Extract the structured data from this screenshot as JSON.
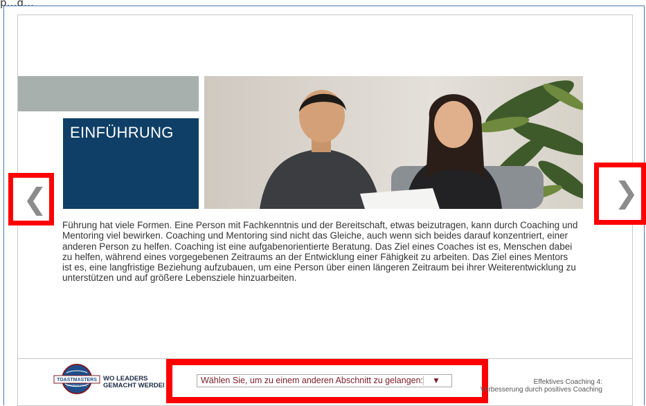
{
  "top_cutoff_text": "p…g…",
  "section": {
    "title": "EINFÜHRUNG",
    "body": "Führung hat viele Formen. Eine Person mit Fachkenntnis und der Bereitschaft, etwas beizutragen, kann durch Coaching und Mentoring viel bewirken. Coaching und Mentoring sind nicht das Gleiche, auch wenn sich beides darauf konzentriert, einer anderen Person zu helfen. Coaching ist eine aufgabenorientierte Beratung. Das Ziel eines Coaches ist es, Menschen dabei zu helfen, während eines vorgegebenen Zeitraums an der Entwicklung einer Fähigkeit zu arbeiten. Das Ziel eines Mentors ist es, eine langfristige Beziehung aufzubauen, um eine Person über einen längeren Zeitraum bei ihrer Weiterentwicklung zu unterstützen und auf größere Lebensziele hinzuarbeiten."
  },
  "nav": {
    "prev_glyph": "❮",
    "next_glyph": "❯"
  },
  "footer": {
    "logo_text": "TOASTMASTERS",
    "logo_subtext": "INTERNATIONAL",
    "slogan_line1": "WO LEADERS",
    "slogan_line2": "GEMACHT WERDEN",
    "section_select": {
      "selected": "Wählen Sie, um zu einem anderen Abschnitt zu gelangen:",
      "arrow": "▼"
    },
    "course_title_line1": "Effektives Coaching 4:",
    "course_title_line2": "Verbesserung durch positives Coaching"
  },
  "colors": {
    "title_box": "#0f3f66",
    "gray_bar": "#a8b0ad",
    "highlight": "#ff0000",
    "select_text": "#7a1c28"
  },
  "icons": {
    "prev": "chevron-left-icon",
    "next": "chevron-right-icon",
    "dropdown": "triangle-down-icon",
    "logo": "toastmasters-globe-logo"
  }
}
